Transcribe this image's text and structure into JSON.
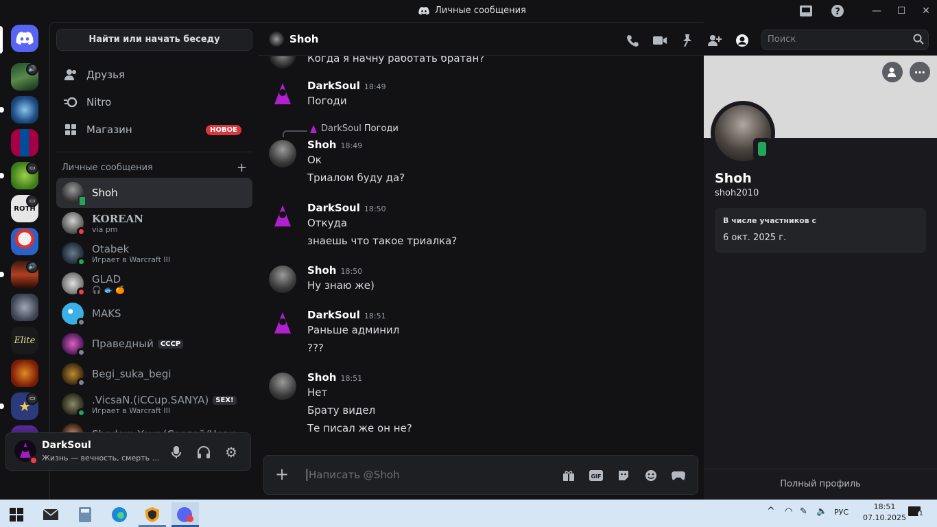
{
  "window": {
    "title": "Личные сообщения"
  },
  "colors": {
    "accent": "#5865f2",
    "online": "#23a55a",
    "dnd": "#f23f43",
    "idle_offline": "#80848e",
    "brand_red": "#da373c"
  },
  "sidebar": {
    "find_button": "Найти или начать беседу",
    "nav": [
      {
        "label": "Друзья",
        "icon": "friends-icon"
      },
      {
        "label": "Nitro",
        "icon": "nitro-icon"
      },
      {
        "label": "Магазин",
        "icon": "shop-icon",
        "badge": "НОВОЕ"
      }
    ],
    "dm_header": "Личные сообщения",
    "dms": [
      {
        "name": "Shoh",
        "status": "mobile",
        "sub": ""
      },
      {
        "name": "KOREAN",
        "status": "dnd",
        "sub": "via pm"
      },
      {
        "name": "Otabek",
        "status": "online",
        "sub": "Играет в Warcraft III"
      },
      {
        "name": "GLAD",
        "status": "dnd",
        "sub": "🎧 🐟 🍊"
      },
      {
        "name": "MAKS",
        "status": "offline",
        "sub": ""
      },
      {
        "name": "Праведный",
        "status": "offline",
        "sub": "",
        "tag": "СССР"
      },
      {
        "name": "Begi_suka_begi",
        "status": "offline",
        "sub": ""
      },
      {
        "name": ".VicsaN.(iCCup.SANYA)",
        "status": "online",
        "sub": "Играет в Warcraft III",
        "tag": "SEX!"
      },
      {
        "name": "Shadow_Your (Сергей/Нович...",
        "status": "offline",
        "sub": ""
      }
    ]
  },
  "user_panel": {
    "name": "DarkSoul",
    "status": "Жизнь — вечность, смерть — мгновение"
  },
  "chat": {
    "recipient": "Shoh",
    "search_placeholder": "Поиск",
    "composer_placeholder": "Написать @Shoh",
    "top_cut_line": "Когда я начну работать братан?",
    "messages": [
      {
        "author": "DarkSoul",
        "time": "18:49",
        "lines": [
          "Погоди"
        ]
      },
      {
        "author": "Shoh",
        "time": "18:49",
        "reply_author": "DarkSoul",
        "reply_text": "Погоди",
        "lines": [
          "Ок",
          "Триалом буду да?"
        ]
      },
      {
        "author": "DarkSoul",
        "time": "18:50",
        "lines": [
          "Откуда",
          "знаешь что такое триалка?"
        ]
      },
      {
        "author": "Shoh",
        "time": "18:50",
        "lines": [
          "Ну знаю же)"
        ]
      },
      {
        "author": "DarkSoul",
        "time": "18:51",
        "lines": [
          "Раньше админил",
          "???"
        ]
      },
      {
        "author": "Shoh",
        "time": "18:51",
        "lines": [
          "Нет",
          "Брату видел",
          "Те писал же он не?"
        ]
      }
    ]
  },
  "profile": {
    "name": "Shoh",
    "username": "shoh2010",
    "member_since_label": "В числе участников с",
    "member_since_value": "6 окт. 2025 г.",
    "full_profile": "Полный профиль"
  },
  "taskbar": {
    "lang": "РУС",
    "time": "18:51",
    "date": "07.10.2025",
    "notif_count": "1"
  }
}
